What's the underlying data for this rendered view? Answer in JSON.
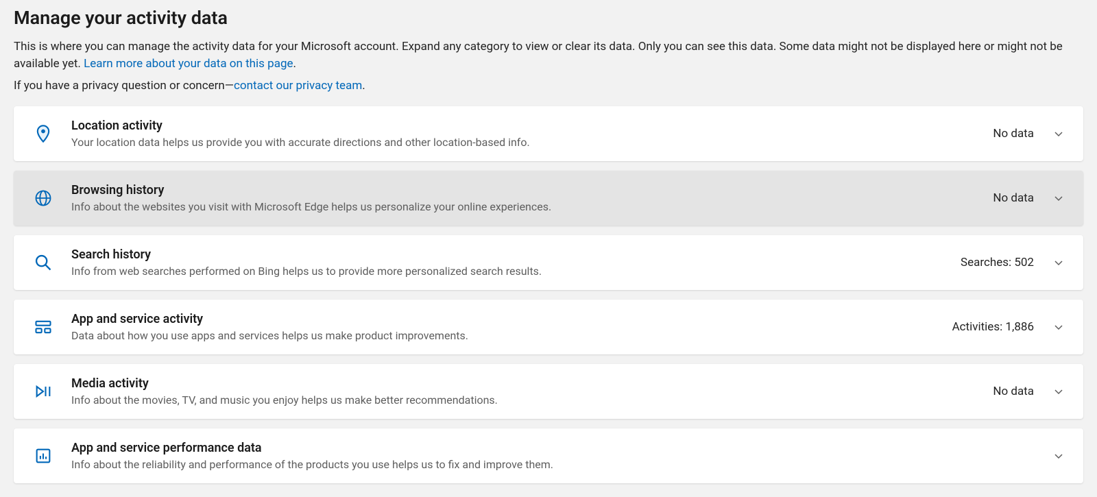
{
  "header": {
    "title": "Manage your activity data",
    "intro_text": "This is where you can manage the activity data for your Microsoft account. Expand any category to view or clear its data. Only you can see this data. Some data might not be displayed here or might not be available yet. ",
    "learn_more_link_text": "Learn more about your data on this page",
    "privacy_prefix": "If you have a privacy question or concern—",
    "privacy_link_text": "contact our privacy team"
  },
  "cards": [
    {
      "title": "Location activity",
      "desc": "Your location data helps us provide you with accurate directions and other location-based info.",
      "status": "No data"
    },
    {
      "title": "Browsing history",
      "desc": "Info about the websites you visit with Microsoft Edge helps us personalize your online experiences.",
      "status": "No data"
    },
    {
      "title": "Search history",
      "desc": "Info from web searches performed on Bing helps us to provide more personalized search results.",
      "status": "Searches: 502"
    },
    {
      "title": "App and service activity",
      "desc": "Data about how you use apps and services helps us make product improvements.",
      "status": "Activities: 1,886"
    },
    {
      "title": "Media activity",
      "desc": "Info about the movies, TV, and music you enjoy helps us make better recommendations.",
      "status": "No data"
    },
    {
      "title": "App and service performance data",
      "desc": "Info about the reliability and performance of the products you use helps us to fix and improve them.",
      "status": ""
    }
  ]
}
